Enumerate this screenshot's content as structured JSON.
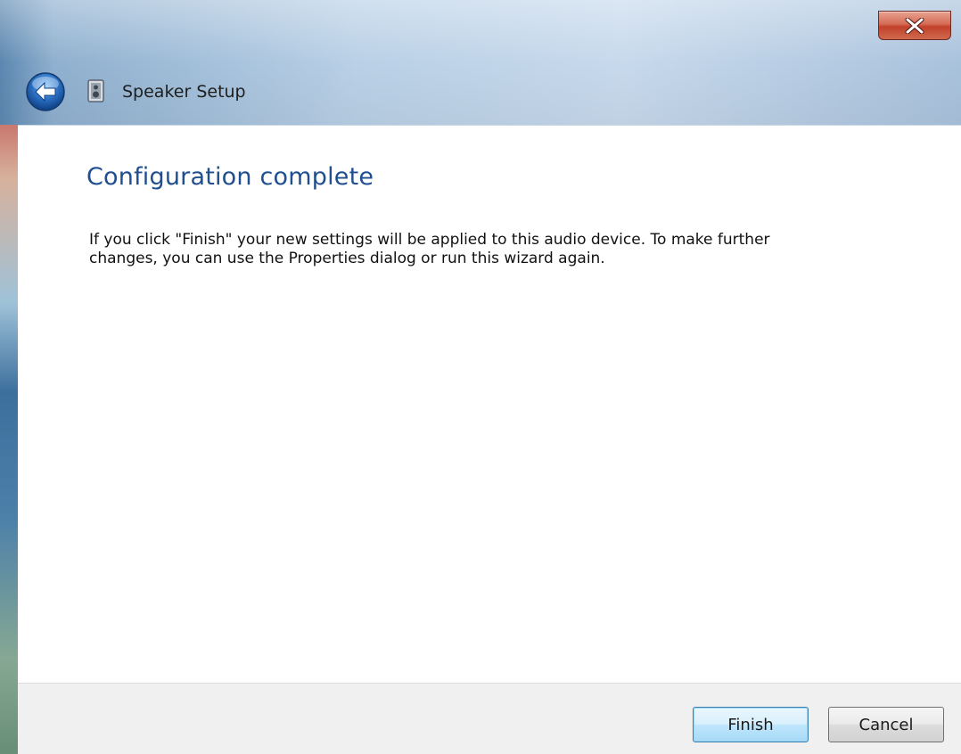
{
  "window": {
    "title": "Speaker Setup",
    "close_icon": "close-icon",
    "back_icon": "back-arrow-icon",
    "app_icon": "speaker-icon"
  },
  "content": {
    "heading": "Configuration complete",
    "body": "If you click \"Finish\" your new settings will be applied to this audio device.  To make further changes, you can use the Properties dialog or run this wizard again."
  },
  "footer": {
    "finish_label": "Finish",
    "cancel_label": "Cancel"
  },
  "colors": {
    "heading": "#1f4f8e",
    "close_button": "#c2412b",
    "back_button": "#2a6fc0"
  }
}
